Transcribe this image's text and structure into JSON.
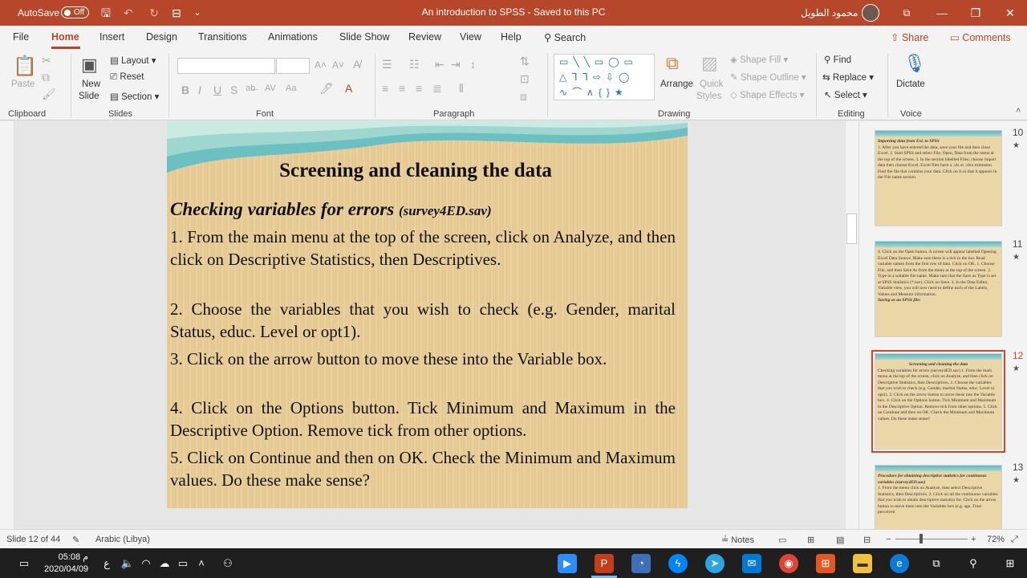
{
  "titlebar": {
    "autosave_label": "AutoSave",
    "autosave_state": "Off",
    "doc_title": "An introduction to SPSS  -  Saved to this PC",
    "user_name": "محمود الطويل"
  },
  "tabs": [
    "File",
    "Home",
    "Insert",
    "Design",
    "Transitions",
    "Animations",
    "Slide Show",
    "Review",
    "View",
    "Help"
  ],
  "active_tab": "Home",
  "search_label": "Search",
  "share_label": "Share",
  "comments_label": "Comments",
  "ribbon": {
    "clipboard": {
      "paste": "Paste",
      "label": "Clipboard"
    },
    "slides": {
      "new_slide_1": "New",
      "new_slide_2": "Slide",
      "layout": "Layout",
      "reset": "Reset",
      "section": "Section",
      "label": "Slides"
    },
    "font": {
      "label": "Font"
    },
    "paragraph": {
      "label": "Paragraph"
    },
    "drawing": {
      "arrange": "Arrange",
      "quick_styles_1": "Quick",
      "quick_styles_2": "Styles",
      "shape_fill": "Shape Fill",
      "shape_outline": "Shape Outline",
      "shape_effects": "Shape Effects",
      "label": "Drawing"
    },
    "editing": {
      "find": "Find",
      "replace": "Replace",
      "select": "Select",
      "label": "Editing"
    },
    "voice": {
      "dictate": "Dictate",
      "label": "Voice"
    }
  },
  "slide": {
    "title": "Screening and cleaning the data",
    "subtitle": "Checking variables for errors",
    "subtitle_file": "(survey4ED.sav)",
    "steps": [
      " 1. From the main menu at the top of the screen, click on Analyze, and then click on Descriptive Statistics, then Descriptives.",
      "2. Choose the variables that you wish to check (e.g. Gender, marital Status, educ. Level or opt1).",
      "3. Click on the arrow button to move these into the Variable box.",
      "4. Click on the Options button. Tick Minimum and Maximum in the Descriptive Option. Remove tick from other options.",
      "5. Click on Continue and then on OK. Check the Minimum and Maximum values. Do these make sense?"
    ]
  },
  "thumbnails": [
    {
      "num": "10",
      "title": "Importing data from Exl. to SPSS",
      "text": "1. After you have entered the data, save your file and then close Excel. 2. Start SPSS and select File, Open, Data from the menu at the top of the screen. 3. In the section labelled Files; choose import data then choose Excel. Excel files have a .xls or .xlsx extension. Find the file that contains your data. Click on it so that it appears in the File name section."
    },
    {
      "num": "11",
      "title": "Saving as an SPSS file:",
      "text": "4. Click on the Open button. A screen will appear labelled Opening Excel Data Source. Make sure there is a tick in the box Read variable names from the first row of data. Click on OK. 1. Choose File, and then Save As from the menu at the top of the screen. 2. Type in a suitable file name. Make sure that the Save as Type is set at SPSS Statistics (*.sav). Click on Save. 3. In the Data Editor, Variable view, you will now need to define each of the Labels, Values and Measure information."
    },
    {
      "num": "12",
      "title": "Screening and cleaning the data",
      "text": "Checking variables for errors (survey4ED.sav) 1. From the main menu at the top of the screen, click on Analyze, and then click on Descriptive Statistics, then Descriptives. 2. Choose the variables that you wish to check (e.g. Gender, marital Status, educ. Level or opt1). 3. Click on the arrow button to move these into the Variable box. 4. Click on the Options button. Tick Minimum and Maximum in the Descriptive Option. Remove tick from other options. 5. Click on Continue and then on OK. Check the Minimum and Maximum values. Do these make sense?"
    },
    {
      "num": "13",
      "title": "Procedure for obtaining descriptive statistics for continuous variables (survey4ED.sav)",
      "text": "1. From the menu click on Analyze, then select Descriptive Statistics, then Descriptives. 2. Click on all the continuous variables that you wish to obtain descriptive statistics for. Click on the arrow button to move them into the Variables box (e.g. age, Total perceived"
    }
  ],
  "selected_thumbnail": "12",
  "status": {
    "slide_counter": "Slide 12 of 44",
    "language": "Arabic (Libya)",
    "notes": "Notes",
    "zoom": "72%"
  },
  "taskbar": {
    "time": "05:08 م",
    "date": "2020/04/09",
    "lang": "ع"
  },
  "colors": {
    "accent": "#b7472a",
    "slide_bg": "#e9cf9b",
    "selection": "#d24726"
  }
}
